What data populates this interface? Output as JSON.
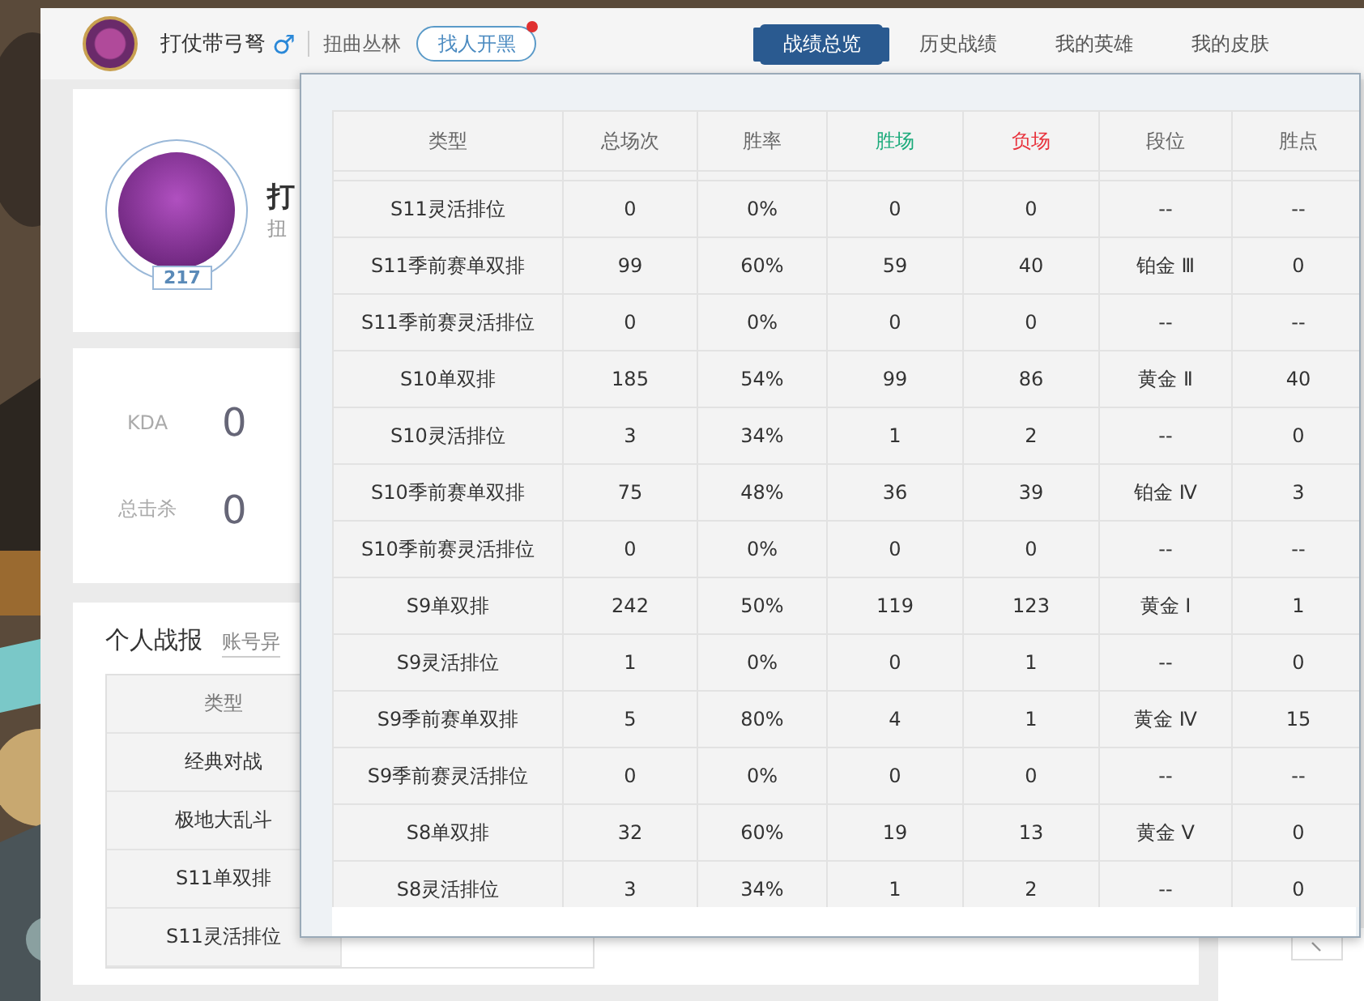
{
  "header": {
    "name": "打仗带弓弩",
    "gender": "♂",
    "region": "扭曲丛林",
    "team_button": {
      "label": "找人开黑",
      "notification": true
    },
    "tabs": [
      {
        "label": "战绩总览",
        "selected": true
      },
      {
        "label": "历史战绩",
        "selected": false
      },
      {
        "label": "我的英雄",
        "selected": false
      },
      {
        "label": "我的皮肤",
        "selected": false
      }
    ]
  },
  "profile": {
    "name": "打",
    "subtitle": "扭",
    "level": "217"
  },
  "stats": [
    {
      "label": "KDA",
      "value": "0"
    },
    {
      "label": "总击杀",
      "value": "0"
    }
  ],
  "report": {
    "title": "个人战报",
    "link": "账号异",
    "column": "类型",
    "rows": [
      "经典对战",
      "极地大乱斗",
      "S11单双排",
      "S11灵活排位"
    ]
  },
  "popup": {
    "columns": [
      {
        "label": "类型"
      },
      {
        "label": "总场次"
      },
      {
        "label": "胜率"
      },
      {
        "label": "胜场",
        "color": "#1aaa7a"
      },
      {
        "label": "负场",
        "color": "#e8323c"
      },
      {
        "label": "段位"
      },
      {
        "label": "胜点"
      }
    ],
    "rows": [
      [
        "S11灵活排位",
        "0",
        "0%",
        "0",
        "0",
        "--",
        "--"
      ],
      [
        "S11季前赛单双排",
        "99",
        "60%",
        "59",
        "40",
        "铂金 Ⅲ",
        "0"
      ],
      [
        "S11季前赛灵活排位",
        "0",
        "0%",
        "0",
        "0",
        "--",
        "--"
      ],
      [
        "S10单双排",
        "185",
        "54%",
        "99",
        "86",
        "黄金 Ⅱ",
        "40"
      ],
      [
        "S10灵活排位",
        "3",
        "34%",
        "1",
        "2",
        "--",
        "0"
      ],
      [
        "S10季前赛单双排",
        "75",
        "48%",
        "36",
        "39",
        "铂金 Ⅳ",
        "3"
      ],
      [
        "S10季前赛灵活排位",
        "0",
        "0%",
        "0",
        "0",
        "--",
        "--"
      ],
      [
        "S9单双排",
        "242",
        "50%",
        "119",
        "123",
        "黄金 Ⅰ",
        "1"
      ],
      [
        "S9灵活排位",
        "1",
        "0%",
        "0",
        "1",
        "--",
        "0"
      ],
      [
        "S9季前赛单双排",
        "5",
        "80%",
        "4",
        "1",
        "黄金 Ⅳ",
        "15"
      ],
      [
        "S9季前赛灵活排位",
        "0",
        "0%",
        "0",
        "0",
        "--",
        "--"
      ],
      [
        "S8单双排",
        "32",
        "60%",
        "19",
        "13",
        "黄金 Ⅴ",
        "0"
      ],
      [
        "S8灵活排位",
        "3",
        "34%",
        "1",
        "2",
        "--",
        "0"
      ]
    ]
  }
}
